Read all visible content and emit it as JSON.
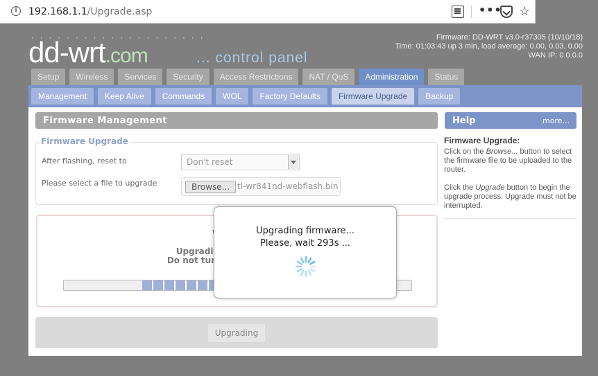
{
  "browser": {
    "url_host": "192.168.1.1",
    "url_path": "/Upgrade.asp"
  },
  "header": {
    "logo_dots": "· · · · · · · · · · · · · · · · · · · ·",
    "logo_main": "dd-wrt",
    "logo_com": ".com",
    "tagline": "... control panel",
    "firmware": "Firmware: DD-WRT v3.0-r37305 (10/10/18)",
    "time": "Time: 01:03:43 up 3 min, load average: 0.00, 0.03, 0.00",
    "wan_ip": "WAN IP: 0.0.0.0"
  },
  "tabs": [
    "Setup",
    "Wireless",
    "Services",
    "Security",
    "Access Restrictions",
    "NAT / QoS",
    "Administration",
    "Status"
  ],
  "active_tab": "Administration",
  "subtabs": [
    "Management",
    "Keep Alive",
    "Commands",
    "WOL",
    "Factory Defaults",
    "Firmware Upgrade",
    "Backup"
  ],
  "active_subtab": "Firmware Upgrade",
  "main": {
    "section_title": "Firmware Management",
    "legend": "Firmware Upgrade",
    "reset_label": "After flashing, reset to",
    "reset_value": "Don't reset",
    "file_label": "Please select a file to upgrade",
    "browse_label": "Browse...",
    "file_name": "tl-wr841nd-webflash.bin",
    "upgrade_title": "W",
    "upgrade_line1": "Upgrading firmw",
    "upgrade_line2": "Do not turn off the p",
    "progress_fraction": 0.24,
    "upgrading_button": "Upgrading"
  },
  "help": {
    "title": "Help",
    "more": "more...",
    "heading": "Firmware Upgrade:",
    "p1_a": "Click on the ",
    "p1_em": "Browse...",
    "p1_b": " button to select the firmware file to be uploaded to the router.",
    "p2_a": "Click the ",
    "p2_em": "Upgrade",
    "p2_b": " button to begin the upgrade process. Upgrade must not be interrupted."
  },
  "modal": {
    "line1": "Upgrading firmware...",
    "line2": "Please, wait 293s ..."
  },
  "colors": {
    "accent": "#7d94c9",
    "active_tab": "#6e8fc8",
    "spinner": "#5ab8e0"
  }
}
